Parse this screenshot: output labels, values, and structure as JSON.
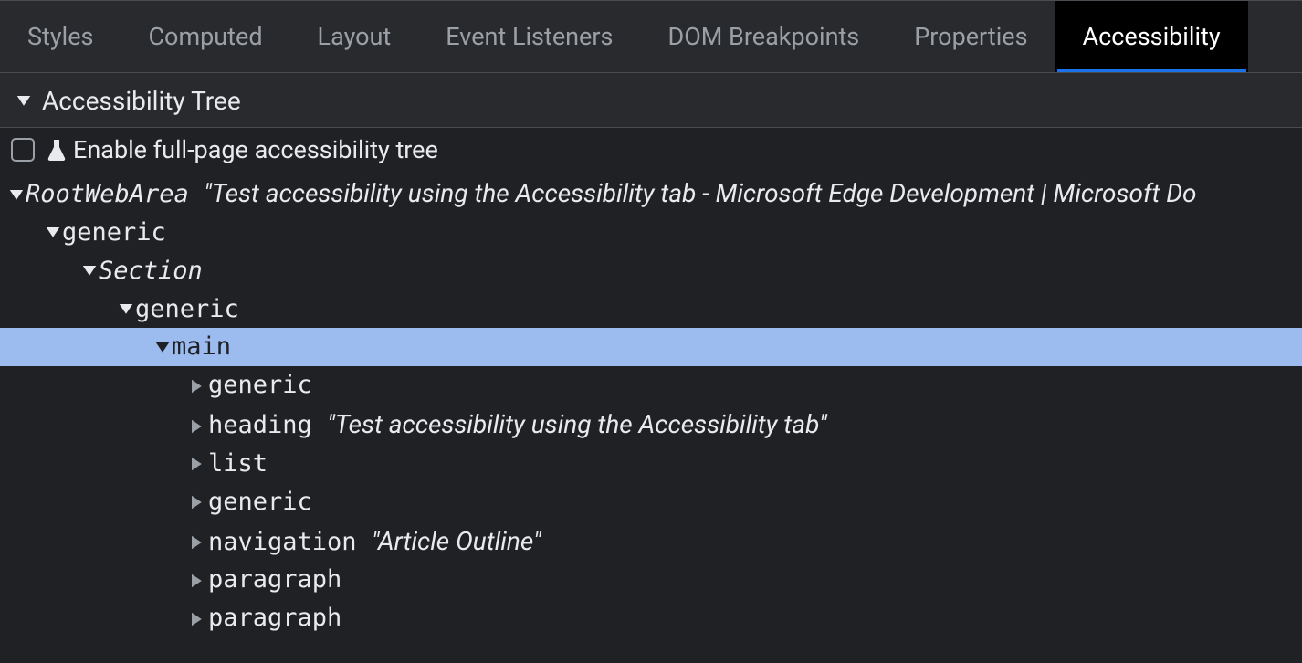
{
  "tabs": [
    {
      "label": "Styles",
      "active": false
    },
    {
      "label": "Computed",
      "active": false
    },
    {
      "label": "Layout",
      "active": false
    },
    {
      "label": "Event Listeners",
      "active": false
    },
    {
      "label": "DOM Breakpoints",
      "active": false
    },
    {
      "label": "Properties",
      "active": false
    },
    {
      "label": "Accessibility",
      "active": true
    }
  ],
  "section": {
    "title": "Accessibility Tree"
  },
  "checkbox": {
    "label": "Enable full-page accessibility tree",
    "checked": false
  },
  "tree": [
    {
      "indent": 0,
      "expanded": true,
      "role": "RootWebArea",
      "roleItalic": true,
      "label": "\"Test accessibility using the Accessibility tab - Microsoft Edge Development | Microsoft Do",
      "selected": false
    },
    {
      "indent": 1,
      "expanded": true,
      "role": "generic",
      "roleItalic": false,
      "label": "",
      "selected": false
    },
    {
      "indent": 2,
      "expanded": true,
      "role": "Section",
      "roleItalic": true,
      "label": "",
      "selected": false
    },
    {
      "indent": 3,
      "expanded": true,
      "role": "generic",
      "roleItalic": false,
      "label": "",
      "selected": false
    },
    {
      "indent": 4,
      "expanded": true,
      "role": "main",
      "roleItalic": false,
      "label": "",
      "selected": true
    },
    {
      "indent": 5,
      "expanded": false,
      "role": "generic",
      "roleItalic": false,
      "label": "",
      "selected": false
    },
    {
      "indent": 5,
      "expanded": false,
      "role": "heading",
      "roleItalic": false,
      "label": "\"Test accessibility using the Accessibility tab\"",
      "selected": false
    },
    {
      "indent": 5,
      "expanded": false,
      "role": "list",
      "roleItalic": false,
      "label": "",
      "selected": false
    },
    {
      "indent": 5,
      "expanded": false,
      "role": "generic",
      "roleItalic": false,
      "label": "",
      "selected": false
    },
    {
      "indent": 5,
      "expanded": false,
      "role": "navigation",
      "roleItalic": false,
      "label": "\"Article Outline\"",
      "selected": false
    },
    {
      "indent": 5,
      "expanded": false,
      "role": "paragraph",
      "roleItalic": false,
      "label": "",
      "selected": false
    },
    {
      "indent": 5,
      "expanded": false,
      "role": "paragraph",
      "roleItalic": false,
      "label": "",
      "selected": false
    }
  ]
}
